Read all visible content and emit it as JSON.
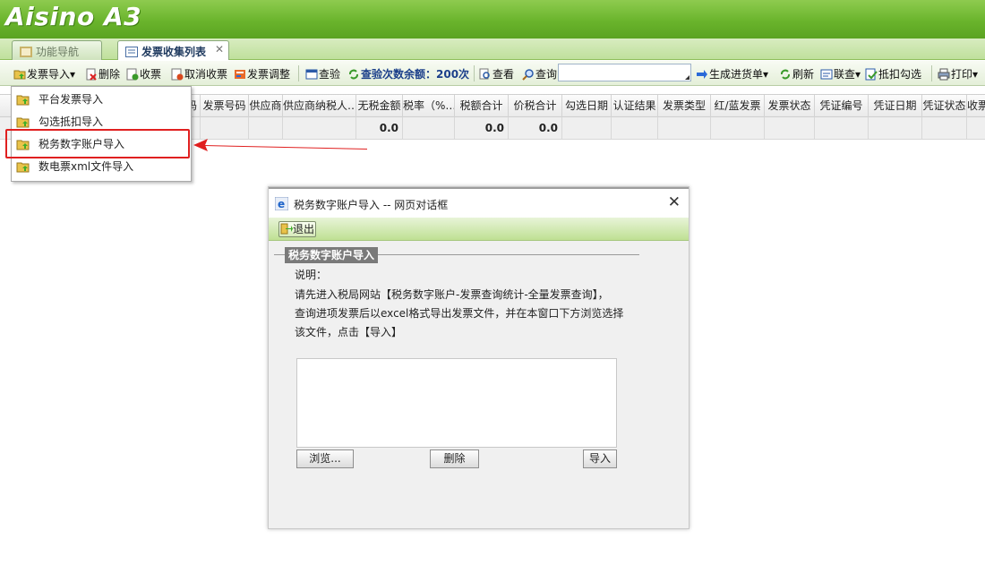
{
  "app": {
    "logo": "Aisino A3"
  },
  "tabs": [
    {
      "label": "功能导航"
    },
    {
      "label": "发票收集列表"
    }
  ],
  "tab_close": "✕",
  "toolbar": {
    "import": "发票导入▾",
    "delete": "删除",
    "collect": "收票",
    "cancel_collect": "取消收票",
    "adjust": "发票调整",
    "verify": "查验",
    "verify_remaining": "查验次数余额：200次",
    "view": "查看",
    "query": "查询",
    "gen_receipt": "生成进货单▾",
    "refresh": "刷新",
    "link_query": "联查▾",
    "deduct_select": "抵扣勾选",
    "print": "打印▾"
  },
  "columns": [
    "码",
    "发票号码",
    "供应商",
    "供应商纳税人…",
    "无税金额",
    "税率（%…",
    "税额合计",
    "价税合计",
    "勾选日期",
    "认证结果",
    "发票类型",
    "红/蓝发票",
    "发票状态",
    "凭证编号",
    "凭证日期",
    "凭证状态",
    "收票"
  ],
  "totals": {
    "amount": "0.0",
    "tax": "0.0",
    "total": "0.0"
  },
  "dropdown": {
    "items": [
      {
        "label": "平台发票导入"
      },
      {
        "label": "勾选抵扣导入"
      },
      {
        "label": "税务数字账户导入"
      },
      {
        "label": "数电票xml文件导入"
      }
    ]
  },
  "dialog": {
    "title": "税务数字账户导入 -- 网页对话框",
    "exit": "退出",
    "section": "税务数字账户导入",
    "desc_label": "说明：",
    "line1": "请先进入税局网站【税务数字账户-发票查询统计-全量发票查询】，",
    "line2": "查询进项发票后以excel格式导出发票文件，并在本窗口下方浏览选择",
    "line3": "该文件，点击【导入】",
    "browse": "浏览...",
    "delete": "删除",
    "import": "导入"
  },
  "colors": {
    "banner": "#6ab42c",
    "highlight": "#e02020",
    "section_bg": "#7a7a7a"
  }
}
